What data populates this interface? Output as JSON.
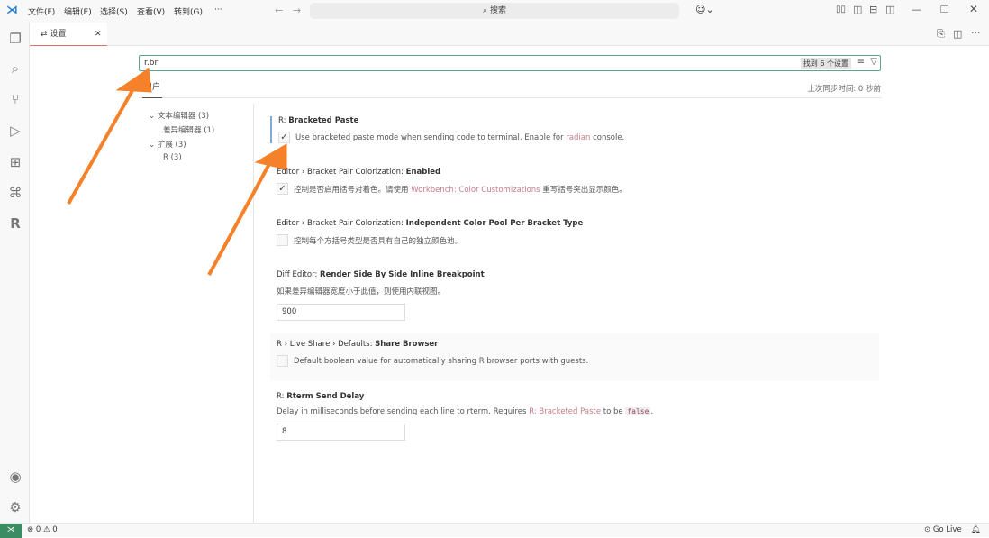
{
  "titlebar": {
    "menus": [
      "文件(F)",
      "编辑(E)",
      "选择(S)",
      "查看(V)",
      "转到(G)",
      "···"
    ],
    "command_center": "搜索"
  },
  "tab": {
    "label": "设置"
  },
  "search": {
    "value": "r.br",
    "found": "找到 6 个设置"
  },
  "scope": {
    "user_tab": "用户",
    "sync": "上次同步时间: 0 秒前"
  },
  "toc": [
    {
      "label": "文本编辑器 (3)"
    },
    {
      "label": "差异编辑器 (1)"
    },
    {
      "label": "扩展 (3)"
    },
    {
      "label": "R (3)"
    }
  ],
  "settings": [
    {
      "prefix": "R: ",
      "name": "Bracketed Paste",
      "desc_pre": "Use bracketed paste mode when sending code to terminal. Enable for ",
      "link": "radian",
      "desc_post": " console.",
      "checked": true
    },
    {
      "prefix": "Editor › Bracket Pair Colorization: ",
      "name": "Enabled",
      "desc_pre": "控制是否启用括号对着色。请使用 ",
      "link": "Workbench: Color Customizations",
      "desc_post": " 重写括号突出显示颜色。",
      "checked": true
    },
    {
      "prefix": "Editor › Bracket Pair Colorization: ",
      "name": "Independent Color Pool Per Bracket Type",
      "desc": "控制每个方括号类型是否具有自己的独立颜色池。",
      "checked": false
    },
    {
      "prefix": "Diff Editor: ",
      "name": "Render Side By Side Inline Breakpoint",
      "desc": "如果差异编辑器宽度小于此值，则使用内联视图。",
      "value": "900"
    },
    {
      "prefix": "R › Live Share › Defaults: ",
      "name": "Share Browser",
      "desc": "Default boolean value for automatically sharing R browser ports with guests.",
      "checked": false
    },
    {
      "prefix": "R: ",
      "name": "Rterm Send Delay",
      "desc_pre": "Delay in milliseconds before sending each line to rterm. Requires ",
      "link": "R: Bracketed Paste",
      "desc_mid": " to be ",
      "code": "false",
      "desc_post": ".",
      "value": "8"
    }
  ],
  "status": {
    "errors": "0",
    "warnings": "0",
    "golive": "Go Live"
  },
  "colors": {
    "accent": "#5fa58b",
    "annotation_arrow": "#f5822a",
    "link": "#c77c8b"
  }
}
